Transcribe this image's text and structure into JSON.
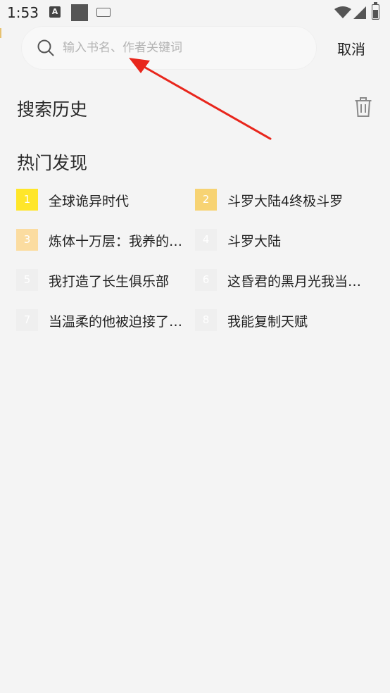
{
  "status_bar": {
    "time": "1:53",
    "icons": [
      "a-notification-icon",
      "square-notification-icon",
      "keyboard-icon",
      "wifi-icon",
      "signal-icon",
      "battery-icon"
    ],
    "a_letter": "A"
  },
  "search": {
    "placeholder": "输入书名、作者关键词",
    "value": "",
    "cancel_label": "取消"
  },
  "history": {
    "title": "搜索历史",
    "clear_icon": "trash-icon"
  },
  "hot": {
    "title": "热门发现",
    "items": [
      {
        "rank": "1",
        "title": "全球诡异时代",
        "badge_color": "#ffe629"
      },
      {
        "rank": "2",
        "title": "斗罗大陆4终极斗罗",
        "badge_color": "#f7d373"
      },
      {
        "rank": "3",
        "title": "炼体十万层：我养的狗都是大帝",
        "badge_color": "#fbdca0"
      },
      {
        "rank": "4",
        "title": "斗罗大陆",
        "badge_color": "#efefef"
      },
      {
        "rank": "5",
        "title": "我打造了长生俱乐部",
        "badge_color": "#efefef"
      },
      {
        "rank": "6",
        "title": "这昏君的黑月光我当定了",
        "badge_color": "#efefef"
      },
      {
        "rank": "7",
        "title": "当温柔的他被迫接了恶毒剧本",
        "badge_color": "#efefef"
      },
      {
        "rank": "8",
        "title": "我能复制天赋",
        "badge_color": "#efefef"
      }
    ]
  },
  "colors": {
    "background": "#f4f4f4",
    "search_box": "#f8f8f8",
    "annotation_arrow": "#e8261c"
  }
}
